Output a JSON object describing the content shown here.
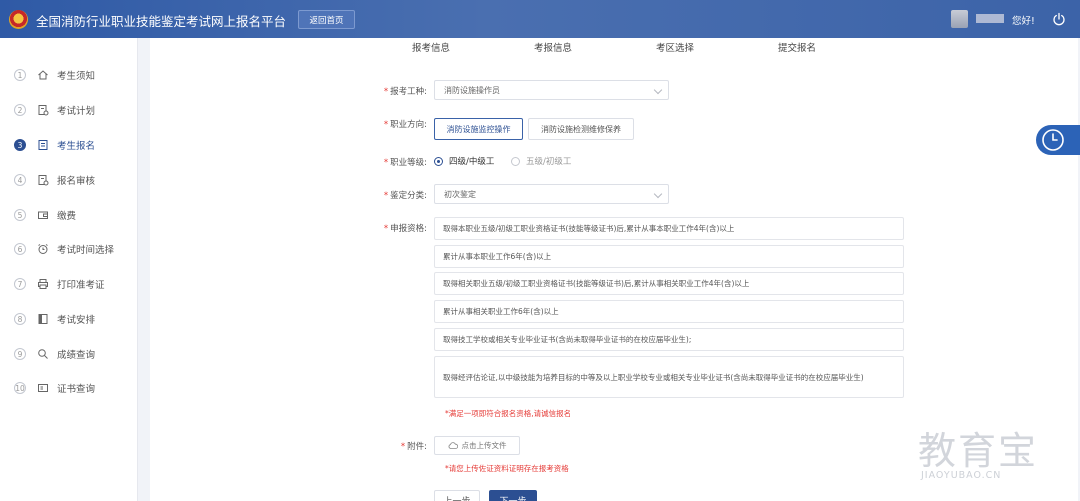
{
  "header": {
    "title": "全国消防行业职业技能鉴定考试网上报名平台",
    "home_button": "返回首页",
    "greeting": "您好!"
  },
  "sidebar": {
    "items": [
      {
        "num": "1",
        "label": "考生须知",
        "icon": "home-icon"
      },
      {
        "num": "2",
        "label": "考试计划",
        "icon": "doc-icon"
      },
      {
        "num": "3",
        "label": "考生报名",
        "icon": "form-icon",
        "active": true
      },
      {
        "num": "4",
        "label": "报名审核",
        "icon": "doc-check-icon"
      },
      {
        "num": "5",
        "label": "缴费",
        "icon": "wallet-icon"
      },
      {
        "num": "6",
        "label": "考试时间选择",
        "icon": "alarm-clock-icon"
      },
      {
        "num": "7",
        "label": "打印准考证",
        "icon": "printer-icon"
      },
      {
        "num": "8",
        "label": "考试安排",
        "icon": "schedule-icon"
      },
      {
        "num": "9",
        "label": "成绩查询",
        "icon": "search-icon"
      },
      {
        "num": "10",
        "label": "证书查询",
        "icon": "certificate-icon"
      }
    ]
  },
  "steps": [
    "报考信息",
    "考报信息",
    "考区选择",
    "提交报名"
  ],
  "form": {
    "job_type": {
      "label": "报考工种:",
      "value": "消防设施操作员"
    },
    "direction": {
      "label": "职业方向:",
      "options": [
        "消防设施监控操作",
        "消防设施检测维修保养"
      ],
      "selected": 0
    },
    "level": {
      "label": "职业等级:",
      "options": [
        "四级/中级工",
        "五级/初级工"
      ],
      "selected": 0
    },
    "category": {
      "label": "鉴定分类:",
      "value": "初次鉴定"
    },
    "qualification": {
      "label": "申报资格:",
      "options": [
        "取得本职业五级/初级工职业资格证书(技能等级证书)后,累计从事本职业工作4年(含)以上",
        "累计从事本职业工作6年(含)以上",
        "取得相关职业五级/初级工职业资格证书(技能等级证书)后,累计从事相关职业工作4年(含)以上",
        "累计从事相关职业工作6年(含)以上",
        "取得技工学校或相关专业毕业证书(含尚未取得毕业证书的在校应届毕业生);",
        "取得经评估论证,以中级技能为培养目标的中等及以上职业学校专业或相关专业毕业证书(含尚未取得毕业证书的在校应届毕业生)"
      ],
      "note": "*满足一项即符合报名资格,请诚信报名"
    },
    "attachment": {
      "label": "附件:",
      "button": "点击上传文件",
      "note": "*请您上传佐证资料证明存在报考资格"
    },
    "prev_button": "上一步",
    "next_button": "下一步"
  },
  "watermark": {
    "text": "教育宝",
    "url": "JIAOYUBAO.CN"
  }
}
